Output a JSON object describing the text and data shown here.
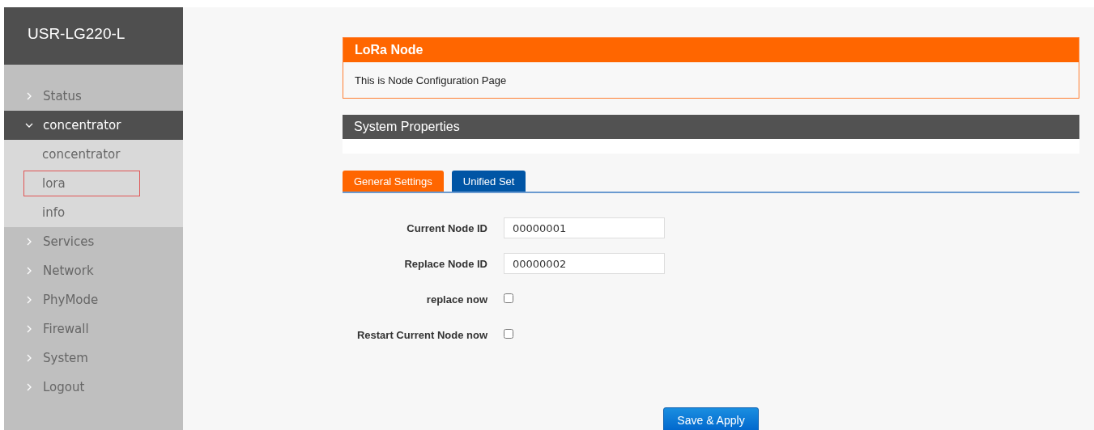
{
  "sidebar": {
    "title": "USR-LG220-L",
    "items": [
      {
        "label": "Status",
        "expanded": false
      },
      {
        "label": "concentrator",
        "expanded": true,
        "children": [
          {
            "label": "concentrator",
            "highlighted": false
          },
          {
            "label": "lora",
            "highlighted": true
          },
          {
            "label": "info",
            "highlighted": false
          }
        ]
      },
      {
        "label": "Services",
        "expanded": false
      },
      {
        "label": "Network",
        "expanded": false
      },
      {
        "label": "PhyMode",
        "expanded": false
      },
      {
        "label": "Firewall",
        "expanded": false
      },
      {
        "label": "System",
        "expanded": false
      },
      {
        "label": "Logout",
        "expanded": false
      }
    ]
  },
  "panel": {
    "title": "LoRa Node",
    "description": "This is Node Configuration Page"
  },
  "section": {
    "title": "System Properties"
  },
  "tabs": [
    {
      "label": "General Settings",
      "selected": true
    },
    {
      "label": "Unified Set",
      "selected": false
    }
  ],
  "fields": [
    {
      "kind": "text",
      "label": "Current Node ID",
      "value": "00000001"
    },
    {
      "kind": "text",
      "label": "Replace Node ID",
      "value": "00000002"
    },
    {
      "kind": "checkbox",
      "label": "replace now",
      "checked": false
    },
    {
      "kind": "checkbox",
      "label": "Restart Current Node now",
      "checked": false
    }
  ],
  "save_button": "Save & Apply"
}
